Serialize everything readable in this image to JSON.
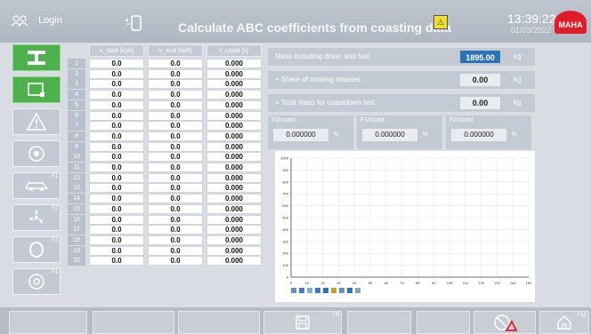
{
  "header": {
    "login_label": "Login",
    "title": "Calculate ABC coefficients from coasting data",
    "time": "13:39:22",
    "date": "01/03/2022",
    "brand": "MAHA"
  },
  "sidebar": {
    "items": [
      {
        "name": "axle-icon",
        "num": ""
      },
      {
        "name": "screen-icon",
        "num": ""
      },
      {
        "name": "warning-icon",
        "num": ""
      },
      {
        "name": "wheel-icon",
        "num": ""
      },
      {
        "name": "car-icon",
        "num": "F1"
      },
      {
        "name": "fan-icon",
        "num": "F2"
      },
      {
        "name": "tire-icon",
        "num": "F3"
      },
      {
        "name": "brake-icon",
        "num": "F4"
      }
    ]
  },
  "table": {
    "headers": [
      "v_start [kph]",
      "v_end [kph]",
      "t_coast [s]"
    ],
    "rows": [
      [
        "1",
        "0.0",
        "0.0",
        "0.000"
      ],
      [
        "2",
        "0.0",
        "0.0",
        "0.000"
      ],
      [
        "3",
        "0.0",
        "0.0",
        "0.000"
      ],
      [
        "4",
        "0.0",
        "0.0",
        "0.000"
      ],
      [
        "5",
        "0.0",
        "0.0",
        "0.000"
      ],
      [
        "6",
        "0.0",
        "0.0",
        "0.000"
      ],
      [
        "7",
        "0.0",
        "0.0",
        "0.000"
      ],
      [
        "8",
        "0.0",
        "0.0",
        "0.000"
      ],
      [
        "9",
        "0.0",
        "0.0",
        "0.000"
      ],
      [
        "10",
        "0.0",
        "0.0",
        "0.000"
      ],
      [
        "11",
        "0.0",
        "0.0",
        "0.000"
      ],
      [
        "12",
        "0.0",
        "0.0",
        "0.000"
      ],
      [
        "13",
        "0.0",
        "0.0",
        "0.000"
      ],
      [
        "14",
        "0.0",
        "0.0",
        "0.000"
      ],
      [
        "15",
        "0.0",
        "0.0",
        "0.000"
      ],
      [
        "16",
        "0.0",
        "0.0",
        "0.000"
      ],
      [
        "17",
        "0.0",
        "0.0",
        "0.000"
      ],
      [
        "18",
        "0.0",
        "0.0",
        "0.000"
      ],
      [
        "19",
        "0.0",
        "0.0",
        "0.000"
      ],
      [
        "20",
        "0.0",
        "0.0",
        "0.000"
      ]
    ]
  },
  "params": {
    "mass": {
      "label": "Mass including driver and fuel",
      "value": "1895.00",
      "unit": "kg"
    },
    "rotating": {
      "label": "+ Share of rotating masses",
      "value": "0.00",
      "unit": "kg"
    },
    "total": {
      "label": "= Total mass for coastdown test",
      "value": "0.00",
      "unit": "kg"
    }
  },
  "coefficients": [
    {
      "label": "F0/coast",
      "value": "0.000000",
      "unit": "N"
    },
    {
      "label": "F1/coast",
      "value": "0.000000",
      "unit": "N"
    },
    {
      "label": "F2/coast",
      "value": "0.000000",
      "unit": "N"
    }
  ],
  "chart_data": {
    "type": "line",
    "x_ticks": [
      "0",
      "10",
      "20",
      "30",
      "40",
      "50",
      "60",
      "70",
      "80",
      "90",
      "100",
      "110",
      "120",
      "130",
      "140",
      "150"
    ],
    "y_ticks": [
      "0",
      "100",
      "200",
      "300",
      "400",
      "500",
      "600",
      "700",
      "800",
      "900",
      "1000"
    ],
    "series": []
  },
  "bottombar": {
    "save_num": "F5",
    "home_num": "F12"
  },
  "colors": {
    "active": "#4eb24c",
    "accent": "#2b73b5",
    "brand": "#e01b2a"
  }
}
